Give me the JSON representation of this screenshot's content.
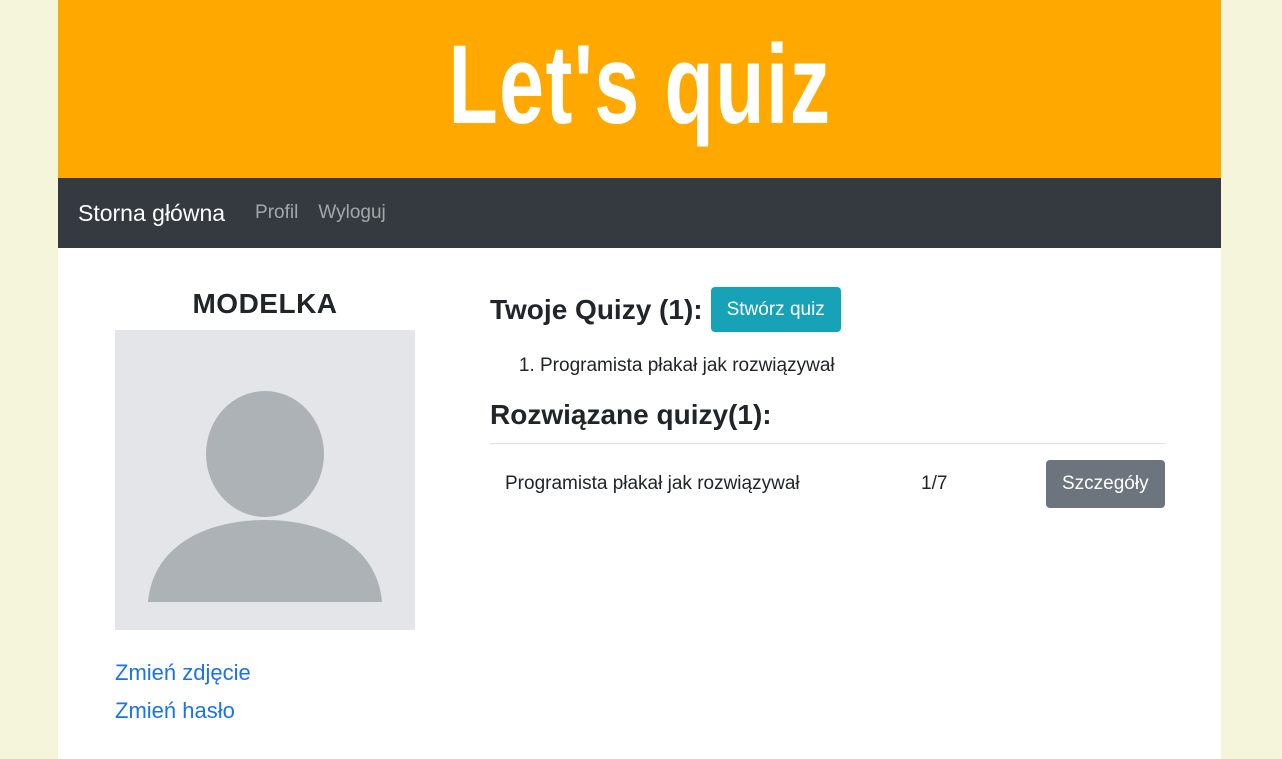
{
  "banner": {
    "title": "Let's quiz"
  },
  "nav": {
    "brand": "Storna główna",
    "links": [
      "Profil",
      "Wyloguj"
    ]
  },
  "profile": {
    "username": "MODELKA",
    "links": [
      "Zmień zdjęcie",
      "Zmień hasło"
    ]
  },
  "my_quizzes": {
    "title": "Twoje Quizy (1):",
    "create_label": "Stwórz quiz",
    "items": [
      "Programista płakał jak rozwiązywał"
    ]
  },
  "solved": {
    "title": "Rozwiązane quizy(1):",
    "rows": [
      {
        "name": "Programista płakał jak rozwiązywał",
        "score": "1/7",
        "action": "Szczegóły"
      }
    ]
  },
  "colors": {
    "banner": "#ffa900",
    "navbar": "#343a40",
    "create_button": "#17a2b8",
    "details_button": "#6c757d",
    "link": "#1a73e8"
  },
  "icons": {
    "avatar": "user-placeholder-icon"
  }
}
